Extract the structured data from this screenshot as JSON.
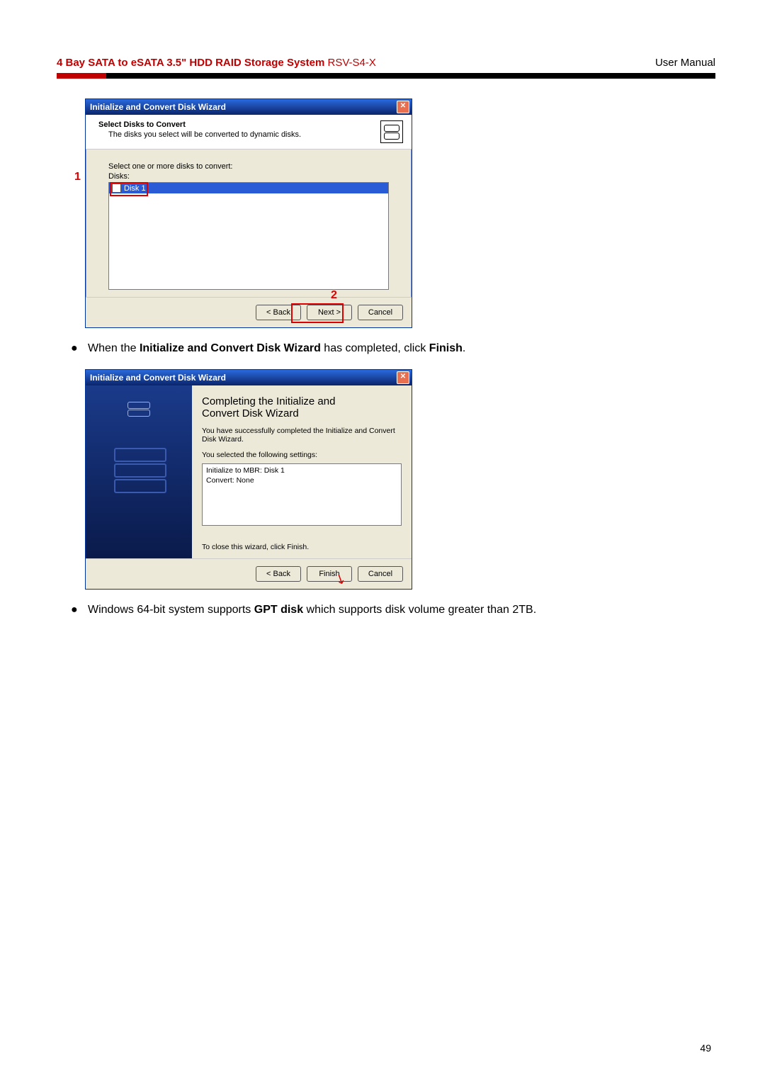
{
  "header": {
    "title_bold": "4 Bay SATA to eSATA 3.5\" HDD RAID Storage System ",
    "title_thin": "RSV-S4-X",
    "right": "User Manual"
  },
  "dialog1": {
    "title": "Initialize and Convert Disk Wizard",
    "header_title": "Select Disks to Convert",
    "header_sub": "The disks you select will be converted to dynamic disks.",
    "body_label1": "Select one or more disks to convert:",
    "body_label2": "Disks:",
    "disk_item": "Disk 1",
    "ann1": "1",
    "ann2": "2",
    "btn_back": "< Back",
    "btn_next": "Next >",
    "btn_cancel": "Cancel",
    "close_glyph": "✕"
  },
  "bullet1": {
    "pre": "When the ",
    "bold1": "Initialize and Convert Disk Wizard",
    "mid": " has completed, click ",
    "bold2": "Finish",
    "post": "."
  },
  "dialog2": {
    "title": "Initialize and Convert Disk Wizard",
    "big_title_line1": "Completing the Initialize and",
    "big_title_line2": "Convert Disk Wizard",
    "para1": "You have successfully completed the Initialize and Convert Disk Wizard.",
    "para2": "You selected the following settings:",
    "setting1": "Initialize to MBR: Disk 1",
    "setting2": "Convert: None",
    "para3": "To close this wizard, click Finish.",
    "btn_back": "< Back",
    "btn_finish": "Finish",
    "btn_cancel": "Cancel",
    "close_glyph": "✕"
  },
  "bullet2": {
    "pre": "Windows 64-bit system supports ",
    "bold1": "GPT disk",
    "post": " which supports disk volume greater than 2TB."
  },
  "page_number": "49"
}
